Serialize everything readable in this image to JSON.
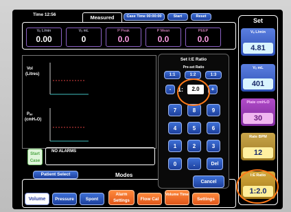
{
  "top": {
    "time": "Time 12:56",
    "measured_tab": "Measured",
    "case_time": "Case Time 00:00:00",
    "start": "Start",
    "reset": "Reset",
    "set_title": "Set"
  },
  "measured": [
    {
      "label": "Vₑ L/min",
      "value": "0.00"
    },
    {
      "label": "Vₓ mL",
      "value": "0"
    },
    {
      "label": "P Peak",
      "value": "0.0"
    },
    {
      "label": "P Mean",
      "value": "0.0"
    },
    {
      "label": "PEEP",
      "value": "0.0"
    }
  ],
  "graph": {
    "vol_label_1": "Vol",
    "vol_label_2": "(Litres)",
    "paw_label_1": "Pₐᵥ",
    "paw_label_2": "(cmH₂O)"
  },
  "alarm": {
    "start_case": "Start Case",
    "message": "NO ALARMS"
  },
  "bottom": {
    "patient_select": "Patient Select",
    "modes": "Modes",
    "mode_buttons": [
      "Volume",
      "Pressure",
      "Spont",
      "Alarm Settings",
      "Flow Cal",
      "Volume Time",
      "Settings"
    ]
  },
  "keypad": {
    "title": "Set I:E Ratio",
    "preset_label": "Pre-set Ratio",
    "presets": [
      "1:1",
      "1:2",
      "1:3"
    ],
    "minus": "-",
    "plus": "+",
    "ratio_prefix": "1:",
    "ratio_value": "2.0",
    "digits": [
      "7",
      "8",
      "9",
      "4",
      "5",
      "6",
      "1",
      "2",
      "3",
      "0",
      "."
    ],
    "del": "Del",
    "cancel": "Cancel"
  },
  "set": [
    {
      "label": "Vₑ L/min",
      "value": "4.81",
      "color": "#d9f4ff"
    },
    {
      "label": "Vₓ mL",
      "value": "401",
      "color": "#d9f4ff"
    },
    {
      "label": "Plate cmH₂O",
      "value": "30",
      "color": "#f0b7f0"
    },
    {
      "label": "Rate BPM",
      "value": "12",
      "color": "#fff0a0"
    },
    {
      "label": "I:E Ratio",
      "value": "1:2.0",
      "color": "#ffef9a"
    }
  ]
}
